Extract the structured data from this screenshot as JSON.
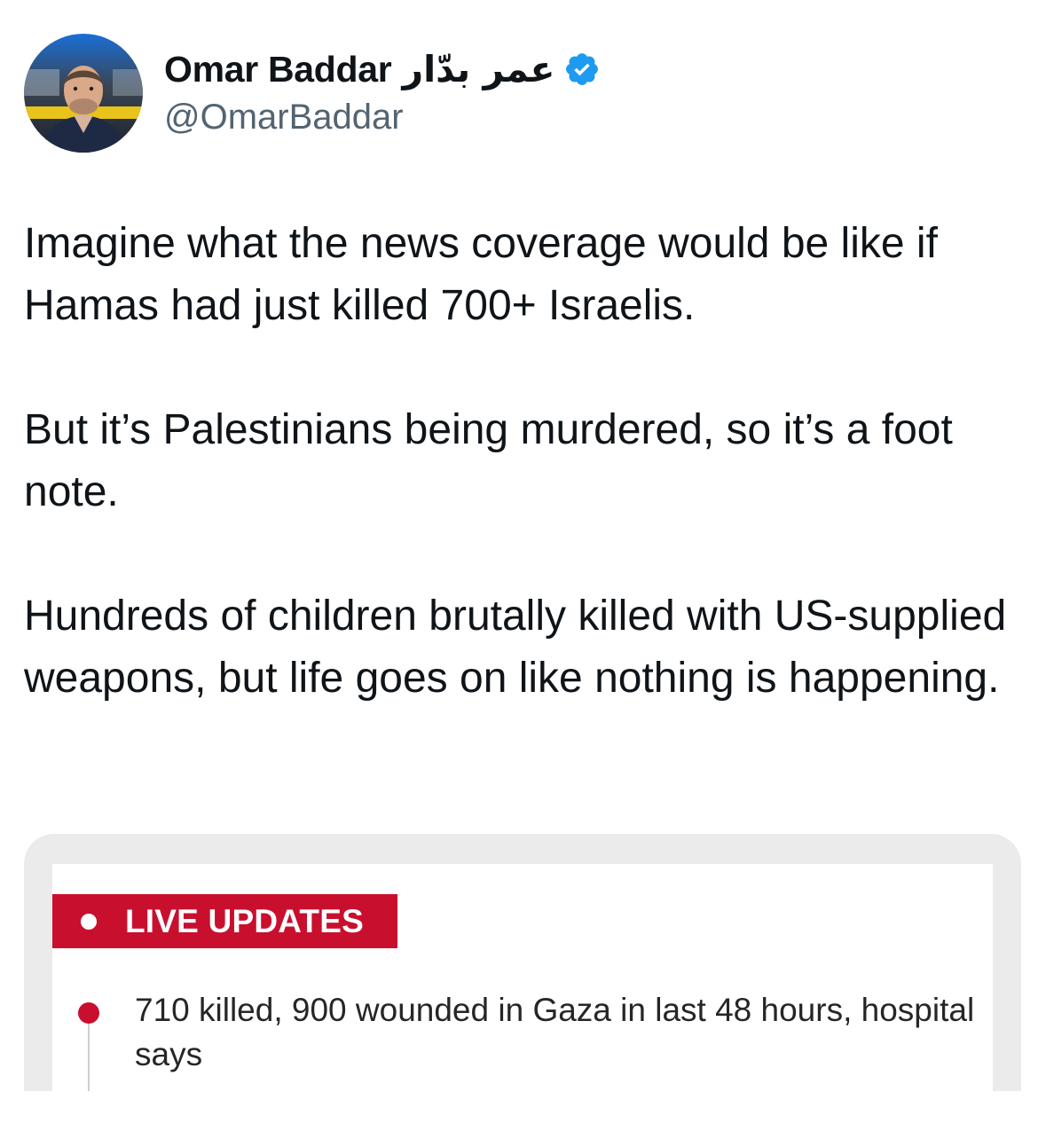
{
  "author": {
    "display_name": "Omar Baddar",
    "arabic_name": "عمر بدّار",
    "handle": "@OmarBaddar",
    "verified": true,
    "verified_icon": "verified-badge-icon",
    "verified_color": "#1d9bf0"
  },
  "tweet": {
    "paragraphs": [
      "Imagine what the news coverage would be like if Hamas had just killed 700+ Israelis.",
      "But it’s Palestinians being murdered, so it’s a foot note.",
      "Hundreds of children brutally killed with US-supplied weapons, but life goes on like nothing is happening."
    ]
  },
  "media": {
    "badge_label": "LIVE UPDATES",
    "badge_color": "#c8102e",
    "headline": "710 killed, 900 wounded in Gaza in last 48 hours, hospital says"
  }
}
